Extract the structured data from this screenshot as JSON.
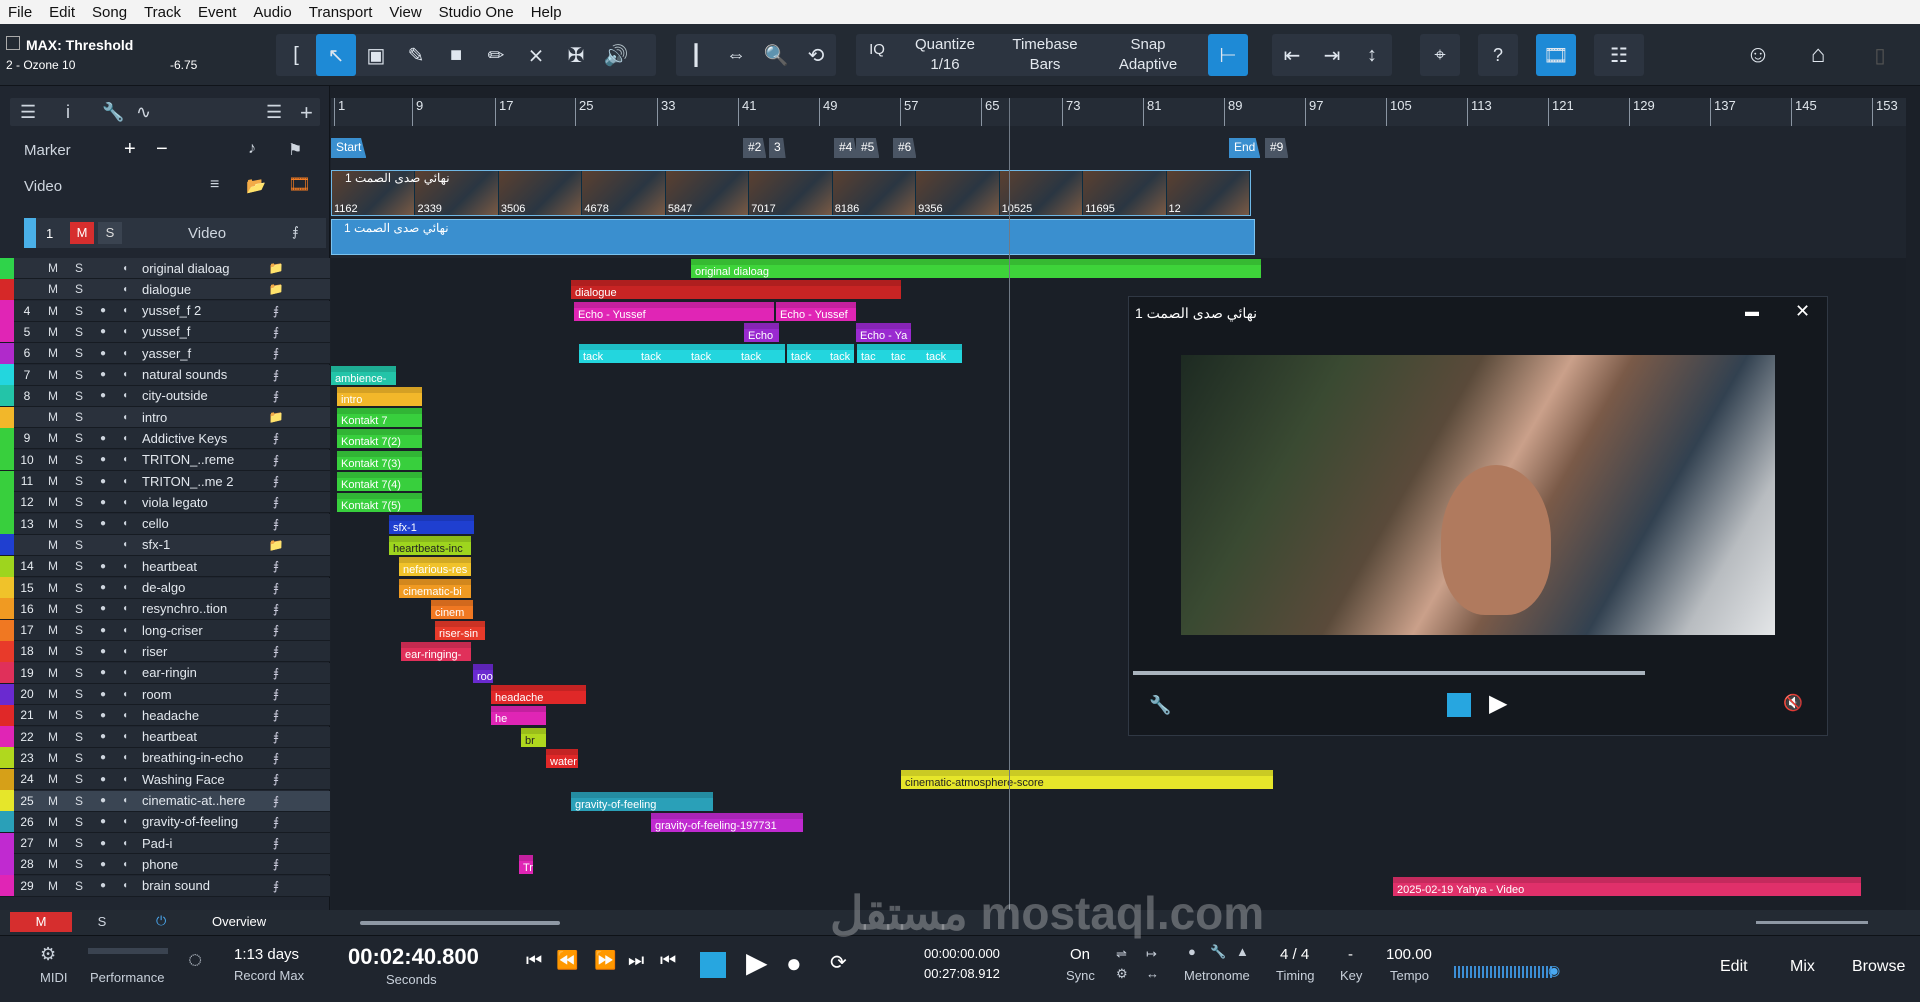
{
  "menu": [
    "File",
    "Edit",
    "Song",
    "Track",
    "Event",
    "Audio",
    "Transport",
    "View",
    "Studio One",
    "Help"
  ],
  "plugin": {
    "title": "MAX: Threshold",
    "device": "2 - Ozone 10",
    "value": "-6.75"
  },
  "toolbar": {
    "iq": "IQ",
    "quantize_label": "Quantize",
    "quantize_value": "1/16",
    "timebase_label": "Timebase",
    "timebase_value": "Bars",
    "snap_label": "Snap",
    "snap_value": "Adaptive",
    "help": "?"
  },
  "inspector": {
    "marker": "Marker",
    "video": "Video",
    "video_track_num": "1",
    "video_track_name": "Video",
    "m": "M",
    "s": "S"
  },
  "ruler": [
    "1",
    "9",
    "17",
    "25",
    "33",
    "41",
    "49",
    "57",
    "65",
    "73",
    "81",
    "89",
    "97",
    "105",
    "113",
    "121",
    "129",
    "137",
    "145",
    "153"
  ],
  "markers": [
    {
      "label": "Start"
    },
    {
      "label": "#2"
    },
    {
      "label": "3"
    },
    {
      "label": "#4"
    },
    {
      "label": "#5"
    },
    {
      "label": "#6"
    },
    {
      "label": "End"
    },
    {
      "label": "#9"
    }
  ],
  "video_clip": {
    "title": "نهائي صدى الصمت 1",
    "frames": [
      "1162",
      "2339",
      "3506",
      "4678",
      "5847",
      "7017",
      "8186",
      "9356",
      "10525",
      "11695",
      "12"
    ]
  },
  "tracks": [
    {
      "num": "",
      "name": "original dialoag",
      "color": "#2fd34a",
      "folder": true
    },
    {
      "num": "",
      "name": "dialogue",
      "color": "#d62828",
      "folder": true
    },
    {
      "num": "4",
      "name": "yussef_f 2",
      "color": "#e025b5"
    },
    {
      "num": "5",
      "name": "yussef_f",
      "color": "#e025b5"
    },
    {
      "num": "6",
      "name": "yasser_f",
      "color": "#b02acb"
    },
    {
      "num": "7",
      "name": "natural sounds",
      "color": "#23d6de"
    },
    {
      "num": "8",
      "name": "city-outside",
      "color": "#23c4a8"
    },
    {
      "num": "",
      "name": "intro",
      "color": "#f2b72a",
      "folder": true
    },
    {
      "num": "9",
      "name": "Addictive Keys",
      "color": "#38cf3d"
    },
    {
      "num": "10",
      "name": "TRITON_..reme",
      "color": "#38cf3d"
    },
    {
      "num": "11",
      "name": "TRITON_..me 2",
      "color": "#38cf3d"
    },
    {
      "num": "12",
      "name": "viola legato",
      "color": "#38cf3d"
    },
    {
      "num": "13",
      "name": "cello",
      "color": "#38cf3d"
    },
    {
      "num": "",
      "name": "sfx-1",
      "color": "#1f3fd0",
      "folder": true
    },
    {
      "num": "14",
      "name": "heartbeat",
      "color": "#9ed51e"
    },
    {
      "num": "15",
      "name": "de-algo",
      "color": "#f0c22a"
    },
    {
      "num": "16",
      "name": "resynchro..tion",
      "color": "#f09a22"
    },
    {
      "num": "17",
      "name": "long-criser",
      "color": "#f07822"
    },
    {
      "num": "18",
      "name": "riser",
      "color": "#e83a2a"
    },
    {
      "num": "19",
      "name": "ear-ringin",
      "color": "#e0305a"
    },
    {
      "num": "20",
      "name": "room",
      "color": "#6a2ad0"
    },
    {
      "num": "21",
      "name": "headache",
      "color": "#e02828"
    },
    {
      "num": "22",
      "name": "heartbeat",
      "color": "#e025b5"
    },
    {
      "num": "23",
      "name": "breathing-in-echo",
      "color": "#b0d81e"
    },
    {
      "num": "24",
      "name": "Washing Face",
      "color": "#d6a018"
    },
    {
      "num": "25",
      "name": "cinematic-at..here",
      "color": "#e6e62a",
      "selected": true
    },
    {
      "num": "26",
      "name": "gravity-of-feeling",
      "color": "#2aa0b8"
    },
    {
      "num": "27",
      "name": "Pad-i",
      "color": "#c02ad0"
    },
    {
      "num": "28",
      "name": "phone",
      "color": "#c02ad0"
    },
    {
      "num": "29",
      "name": "brain sound",
      "color": "#e025b5"
    }
  ],
  "clips": [
    {
      "t": 0,
      "label": "original dialoag",
      "c": "#3ed43a"
    },
    {
      "t": 1,
      "label": "dialogue",
      "c": "#c82424"
    },
    {
      "t": 2,
      "label": "Echo - Yussef",
      "c": "#e025b5"
    },
    {
      "t": 2,
      "label": "Echo - Yussef",
      "c": "#e025b5"
    },
    {
      "t": 3,
      "label": "Echo",
      "c": "#9a2ad0"
    },
    {
      "t": 3,
      "label": "Echo - Ya",
      "c": "#9a2ad0"
    },
    {
      "t": 4,
      "label": "tack",
      "c": "#23d6de"
    },
    {
      "t": 4,
      "label": "tack",
      "c": "#23d6de"
    },
    {
      "t": 4,
      "label": "tack",
      "c": "#23d6de"
    },
    {
      "t": 4,
      "label": "tack",
      "c": "#23d6de"
    },
    {
      "t": 4,
      "label": "tack",
      "c": "#23d6de"
    },
    {
      "t": 4,
      "label": "tack",
      "c": "#23d6de"
    },
    {
      "t": 4,
      "label": "tac",
      "c": "#23d6de"
    },
    {
      "t": 4,
      "label": "tac",
      "c": "#23d6de"
    },
    {
      "t": 4,
      "label": "tack",
      "c": "#23d6de"
    },
    {
      "t": 5,
      "label": "ambience-",
      "c": "#23c4a8"
    },
    {
      "t": 6,
      "label": "intro",
      "c": "#f2b72a"
    },
    {
      "t": 7,
      "label": "Kontakt 7",
      "c": "#38cf3d"
    },
    {
      "t": 8,
      "label": "Kontakt 7(2)",
      "c": "#38cf3d"
    },
    {
      "t": 9,
      "label": "Kontakt 7(3)",
      "c": "#38cf3d"
    },
    {
      "t": 10,
      "label": "Kontakt 7(4)",
      "c": "#38cf3d"
    },
    {
      "t": 11,
      "label": "Kontakt 7(5)",
      "c": "#38cf3d"
    },
    {
      "t": 12,
      "label": "sfx-1",
      "c": "#1f3fd0"
    },
    {
      "t": 13,
      "label": "heartbeats-inc",
      "c": "#9ed51e"
    },
    {
      "t": 14,
      "label": "nefarious-res",
      "c": "#f0c22a"
    },
    {
      "t": 15,
      "label": "cinematic-bi",
      "c": "#f09a22"
    },
    {
      "t": 16,
      "label": "cinem",
      "c": "#f07822"
    },
    {
      "t": 17,
      "label": "riser-sin",
      "c": "#e83a2a"
    },
    {
      "t": 18,
      "label": "ear-ringing-",
      "c": "#e0305a"
    },
    {
      "t": 19,
      "label": "roo",
      "c": "#6a2ad0"
    },
    {
      "t": 20,
      "label": "headache",
      "c": "#e02828"
    },
    {
      "t": 21,
      "label": "he",
      "c": "#e025b5"
    },
    {
      "t": 22,
      "label": "br",
      "c": "#b0d81e"
    },
    {
      "t": 23,
      "label": "water",
      "c": "#e02828"
    },
    {
      "t": 24,
      "label": "cinematic-atmosphere-score",
      "c": "#e6e62a"
    },
    {
      "t": 25,
      "label": "gravity-of-feeling",
      "c": "#2aa0b8"
    },
    {
      "t": 26,
      "label": "gravity-of-feeling-197731",
      "c": "#c02ad0"
    },
    {
      "t": 28,
      "label": "Tr",
      "c": "#e025b5"
    },
    {
      "t": 29,
      "label": "2025-02-19 Yahya - Video",
      "c": "#e0306a"
    }
  ],
  "player": {
    "title": "نهائي صدى الصمت 1",
    "progress": 0.73
  },
  "bottom": {
    "m": "M",
    "s": "S",
    "overview": "Overview",
    "midi": "MIDI",
    "performance": "Performance",
    "days": "1:13 days",
    "record_max": "Record Max",
    "time": "00:02:40.800",
    "seconds": "Seconds",
    "l_time": "00:00:00.000",
    "r_time": "00:27:08.912",
    "on": "On",
    "sync": "Sync",
    "metronome": "Metronome",
    "timing_val": "4 / 4",
    "timing": "Timing",
    "key_val": "-",
    "key": "Key",
    "tempo_val": "100.00",
    "tempo": "Tempo",
    "edit": "Edit",
    "mix": "Mix",
    "browse": "Browse"
  },
  "watermark": "مستقل mostaql.com"
}
